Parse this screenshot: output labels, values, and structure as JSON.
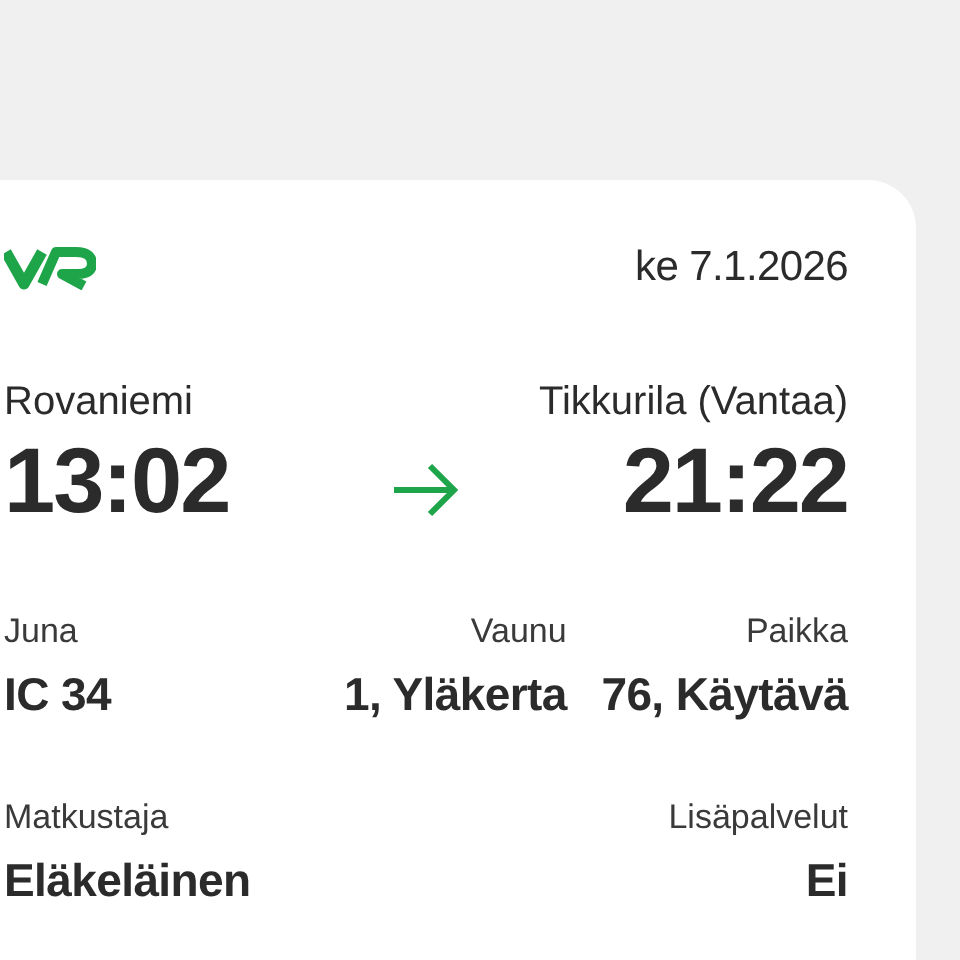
{
  "ticket": {
    "date": "ke 7.1.2026",
    "origin": {
      "station": "Rovaniemi",
      "time": "13:02"
    },
    "destination": {
      "station": "Tikkurila (Vantaa)",
      "time": "21:22"
    },
    "details": [
      {
        "label": "Juna",
        "value": "IC 34"
      },
      {
        "label": "Vaunu",
        "value": "1, Yläkerta"
      },
      {
        "label": "Paikka",
        "value": "76, Käytävä"
      }
    ],
    "extras": [
      {
        "label": "Matkustaja",
        "value": "Eläkeläinen"
      },
      {
        "label": "Lisäpalvelut",
        "value": "Ei"
      }
    ]
  }
}
